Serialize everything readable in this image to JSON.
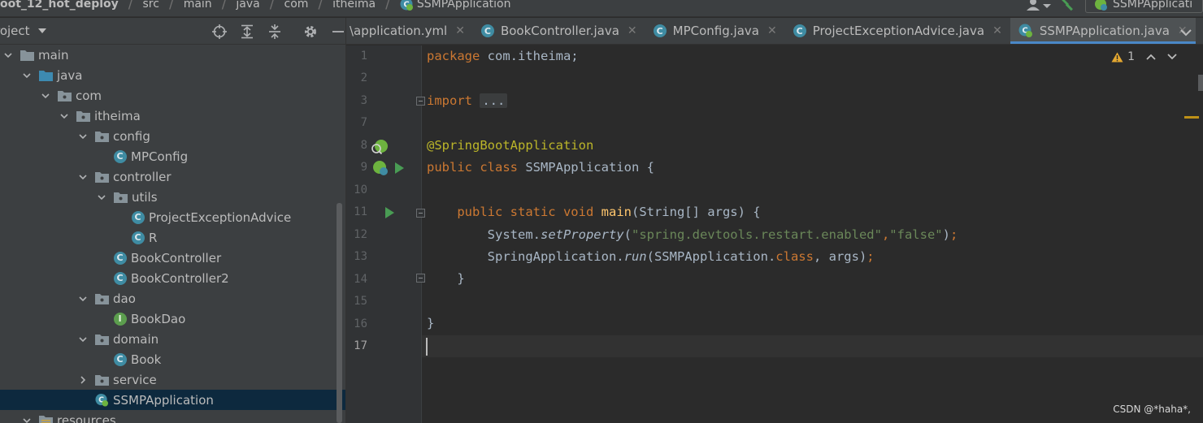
{
  "navbar": {
    "crumbs": [
      "oot_12_hot_deploy",
      "src",
      "main",
      "java",
      "com",
      "itheima",
      "SSMPApplication"
    ],
    "run_config_label": "SSMPApplicati"
  },
  "project_panel": {
    "title": "roject",
    "tree": [
      {
        "label": "main",
        "kind": "folder",
        "expanded": true
      },
      {
        "label": "java",
        "kind": "source-folder",
        "expanded": true
      },
      {
        "label": "com",
        "kind": "package",
        "expanded": true
      },
      {
        "label": "itheima",
        "kind": "package",
        "expanded": true
      },
      {
        "label": "config",
        "kind": "package",
        "expanded": true
      },
      {
        "label": "MPConfig",
        "kind": "class"
      },
      {
        "label": "controller",
        "kind": "package",
        "expanded": true
      },
      {
        "label": "utils",
        "kind": "package",
        "expanded": true
      },
      {
        "label": "ProjectExceptionAdvice",
        "kind": "class"
      },
      {
        "label": "R",
        "kind": "class"
      },
      {
        "label": "BookController",
        "kind": "class"
      },
      {
        "label": "BookController2",
        "kind": "class"
      },
      {
        "label": "dao",
        "kind": "package",
        "expanded": true
      },
      {
        "label": "BookDao",
        "kind": "interface"
      },
      {
        "label": "domain",
        "kind": "package",
        "expanded": true
      },
      {
        "label": "Book",
        "kind": "class"
      },
      {
        "label": "service",
        "kind": "package",
        "expanded": false
      },
      {
        "label": "SSMPApplication",
        "kind": "spring-class",
        "selected": true
      },
      {
        "label": "resources",
        "kind": "folder",
        "expanded": true
      }
    ]
  },
  "tabs": [
    {
      "label": "\\application.yml",
      "active": false,
      "icon": "yml-icon"
    },
    {
      "label": "BookController.java",
      "active": false,
      "icon": "class-icon"
    },
    {
      "label": "MPConfig.java",
      "active": false,
      "icon": "class-icon"
    },
    {
      "label": "ProjectExceptionAdvice.java",
      "active": false,
      "icon": "class-icon"
    },
    {
      "label": "SSMPApplication.java",
      "active": true,
      "icon": "spring-class-icon"
    }
  ],
  "editor": {
    "line_numbers": [
      "1",
      "2",
      "3",
      "7",
      "8",
      "9",
      "10",
      "11",
      "12",
      "13",
      "14",
      "15",
      "16",
      "17"
    ],
    "current_line": "17",
    "inspection_count": "1",
    "code": {
      "l1_kw": "package",
      "l1_rest": " com.itheima;",
      "l3_kw": "import",
      "l3_fold": "...",
      "l8_ann": "@SpringBootApplication",
      "l9_kw": "public class",
      "l9_rest": " SSMPApplication {",
      "l11_kw": "public static void",
      "l11_fn": "main",
      "l11_rest": "(String[] args) {",
      "l12_obj": "System.",
      "l12_method": "setProperty",
      "l12_open": "(",
      "l12_str1": "\"spring.devtools.restart.enabled\"",
      "l12_comma": ",",
      "l12_str2": "\"false\"",
      "l12_close": ")",
      "l12_semi": ";",
      "l13_obj": "SpringApplication.",
      "l13_method": "run",
      "l13_args_a": "(SSMPApplication.",
      "l13_kw": "class",
      "l13_args_b": ", args)",
      "l13_semi": ";",
      "l14": "}",
      "l16": "}"
    }
  },
  "watermark": "CSDN @*haha*,",
  "colors": {
    "background": "#2b2b2b",
    "panel": "#3c3f41",
    "keyword": "#cc7832",
    "annotation": "#bbb529",
    "string": "#6a8759",
    "function": "#ffc66d",
    "accent": "#4a88c7"
  }
}
